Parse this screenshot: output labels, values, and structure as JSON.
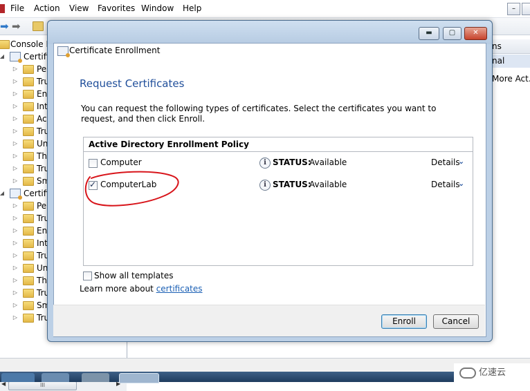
{
  "menubar": {
    "items": [
      "File",
      "Action",
      "View",
      "Favorites",
      "Window",
      "Help"
    ]
  },
  "tree": {
    "root_label": "Console R",
    "group1_label": "Certifi",
    "group1_children": [
      "Per",
      "Tru",
      "Ent",
      "Int",
      "Act",
      "Tru",
      "Un",
      "Th",
      "Tru",
      "Sm"
    ],
    "group2_label": "Certifi",
    "group2_children": [
      "Per",
      "Tru",
      "Ent",
      "Int",
      "Tru",
      "Un",
      "Th",
      "Tru",
      "Sm",
      "Tru"
    ],
    "scroll_thumb_glyph": "III"
  },
  "actions_pane": {
    "header": "ns",
    "subheader": "nal",
    "more_actions": "More Act..."
  },
  "dialog": {
    "title": "Certificate Enrollment",
    "heading": "Request Certificates",
    "description": "You can request the following types of certificates. Select the certificates you want to request, and then click Enroll.",
    "policy_name": "Active Directory Enrollment Policy",
    "templates": [
      {
        "name": "Computer",
        "checked": false,
        "status_label": "STATUS:",
        "status_value": "Available",
        "details": "Details"
      },
      {
        "name": "ComputerLab",
        "checked": true,
        "status_label": "STATUS:",
        "status_value": "Available",
        "details": "Details"
      }
    ],
    "show_all_label": "Show all templates",
    "learn_more_prefix": "Learn more about ",
    "learn_more_link": "certificates",
    "enroll_label": "Enroll",
    "cancel_label": "Cancel"
  },
  "watermark": "亿速云",
  "colors": {
    "heading": "#1f4e9a",
    "link": "#1a5fb4",
    "annotation": "#d8141a"
  }
}
